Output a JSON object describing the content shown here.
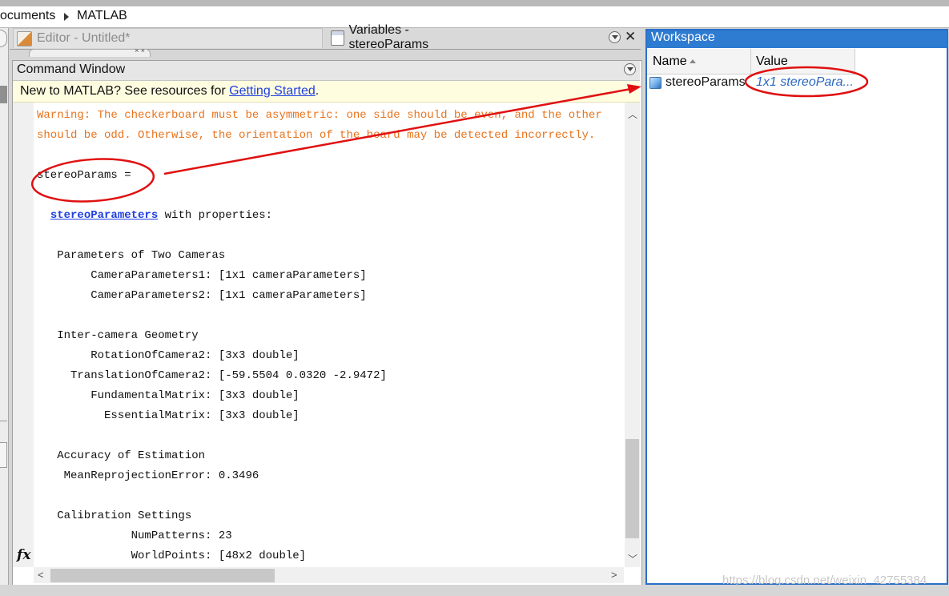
{
  "breadcrumb": {
    "path_start": "ocuments",
    "current": "MATLAB"
  },
  "editor_tabs": [
    {
      "label": "Editor - Untitled*",
      "active": false
    },
    {
      "label": "Variables - stereoParams",
      "active": true
    }
  ],
  "command_window": {
    "title": "Command Window",
    "banner": {
      "prefix": "New to MATLAB? See resources for ",
      "link": "Getting Started",
      "suffix": "."
    },
    "warning": "Warning: The checkerboard must be asymmetric: one side should be even, and the other should be odd. Otherwise, the orientation of the board may be detected incorrectly.",
    "lines": {
      "var_assign": "stereoParams =",
      "class_link": "stereoParameters",
      "class_suffix": " with properties:",
      "sec_cameras": "   Parameters of Two Cameras",
      "cam1": "        CameraParameters1: [1x1 cameraParameters]",
      "cam2": "        CameraParameters2: [1x1 cameraParameters]",
      "sec_geometry": "   Inter-camera Geometry",
      "rot": "        RotationOfCamera2: [3x3 double]",
      "trans": "     TranslationOfCamera2: [-59.5504 0.0320 -2.9472]",
      "fund": "        FundamentalMatrix: [3x3 double]",
      "ess": "          EssentialMatrix: [3x3 double]",
      "sec_accuracy": "   Accuracy of Estimation",
      "mre": "    MeanReprojectionError: 0.3496",
      "sec_calib": "   Calibration Settings",
      "numpat": "              NumPatterns: 23",
      "world": "              WorldPoints: [48x2 double]"
    },
    "prompt_icon": "fx"
  },
  "workspace": {
    "title": "Workspace",
    "columns": {
      "name": "Name",
      "value": "Value"
    },
    "rows": [
      {
        "name": "stereoParams",
        "value": "1x1 stereoPara..."
      }
    ]
  },
  "watermark": "https://blog.csdn.net/weixin_42755384",
  "colors": {
    "annotation": "#e01010",
    "warning": "#e8731d",
    "workspace_accent": "#2e7bd2",
    "link": "#1f3fe0"
  }
}
